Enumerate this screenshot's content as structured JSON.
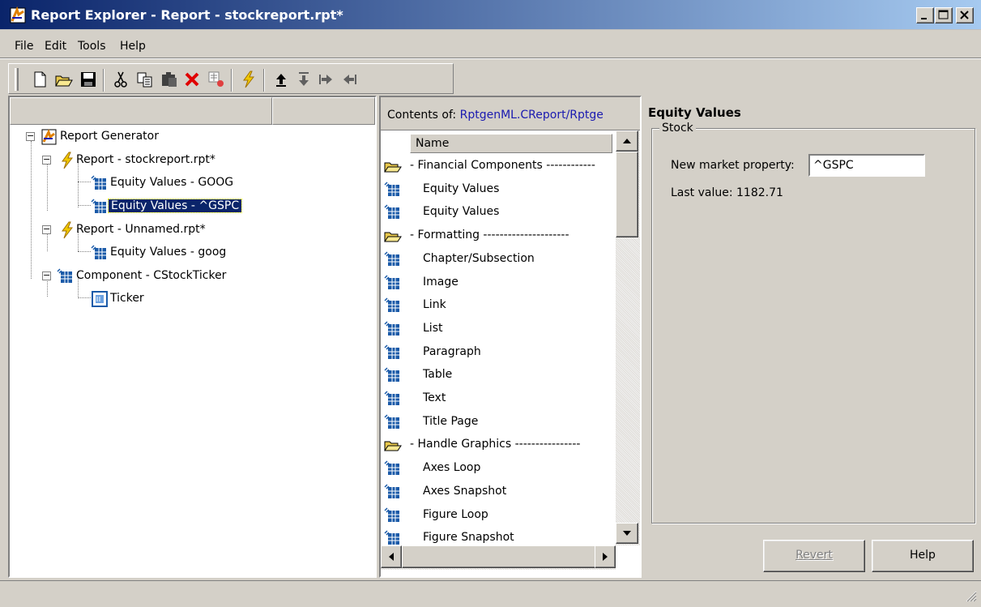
{
  "window": {
    "title": "Report Explorer - Report - stockreport.rpt*"
  },
  "menu": {
    "file": "File",
    "edit": "Edit",
    "tools": "Tools",
    "help": "Help"
  },
  "toolbar": {
    "buttons": [
      "new-icon",
      "open-icon",
      "save-icon",
      "cut-icon",
      "copy-icon",
      "paste-icon",
      "delete-icon",
      "delete-disabled-icon",
      "run-report-icon",
      "move-up-icon",
      "move-down-icon",
      "demote-icon",
      "promote-icon"
    ]
  },
  "tree": {
    "nodes": [
      {
        "label": "Report Generator",
        "icon": "report-generator-icon"
      },
      {
        "label": "Report - stockreport.rpt*",
        "icon": "lightning-icon"
      },
      {
        "label": "Equity Values - GOOG",
        "icon": "component-icon"
      },
      {
        "label": "Equity Values - ^GSPC",
        "icon": "component-icon",
        "selected": true
      },
      {
        "label": "Report - Unnamed.rpt*",
        "icon": "lightning-icon"
      },
      {
        "label": "Equity Values - goog",
        "icon": "component-icon"
      },
      {
        "label": "Component - CStockTicker",
        "icon": "component-icon"
      },
      {
        "label": "Ticker",
        "icon": "ticker-icon"
      }
    ]
  },
  "list": {
    "contents_label": "Contents of:",
    "contents_path": "RptgenML.CReport/Rptge",
    "column_header": "Name",
    "items": [
      {
        "label": "- Financial Components ------------",
        "type": "folder"
      },
      {
        "label": "Equity Values",
        "type": "component"
      },
      {
        "label": "Equity Values",
        "type": "component"
      },
      {
        "label": "- Formatting ---------------------",
        "type": "folder"
      },
      {
        "label": "Chapter/Subsection",
        "type": "component"
      },
      {
        "label": "Image",
        "type": "component"
      },
      {
        "label": "Link",
        "type": "component"
      },
      {
        "label": "List",
        "type": "component"
      },
      {
        "label": "Paragraph",
        "type": "component"
      },
      {
        "label": "Table",
        "type": "component"
      },
      {
        "label": "Text",
        "type": "component"
      },
      {
        "label": "Title Page",
        "type": "component"
      },
      {
        "label": "- Handle Graphics ----------------",
        "type": "folder"
      },
      {
        "label": "Axes Loop",
        "type": "component"
      },
      {
        "label": "Axes Snapshot",
        "type": "component"
      },
      {
        "label": "Figure Loop",
        "type": "component"
      },
      {
        "label": "Figure Snapshot",
        "type": "component"
      }
    ]
  },
  "props": {
    "title": "Equity Values",
    "group_label": "Stock",
    "market_label": "New market property:",
    "market_value": "^GSPC",
    "last_value": "Last value: 1182.71",
    "revert_label": "Revert",
    "help_label": "Help"
  },
  "colors": {
    "titlebar": "#0a246a",
    "selection": "#0a246a",
    "path_text": "#1a1ab0",
    "face": "#d4d0c8"
  }
}
